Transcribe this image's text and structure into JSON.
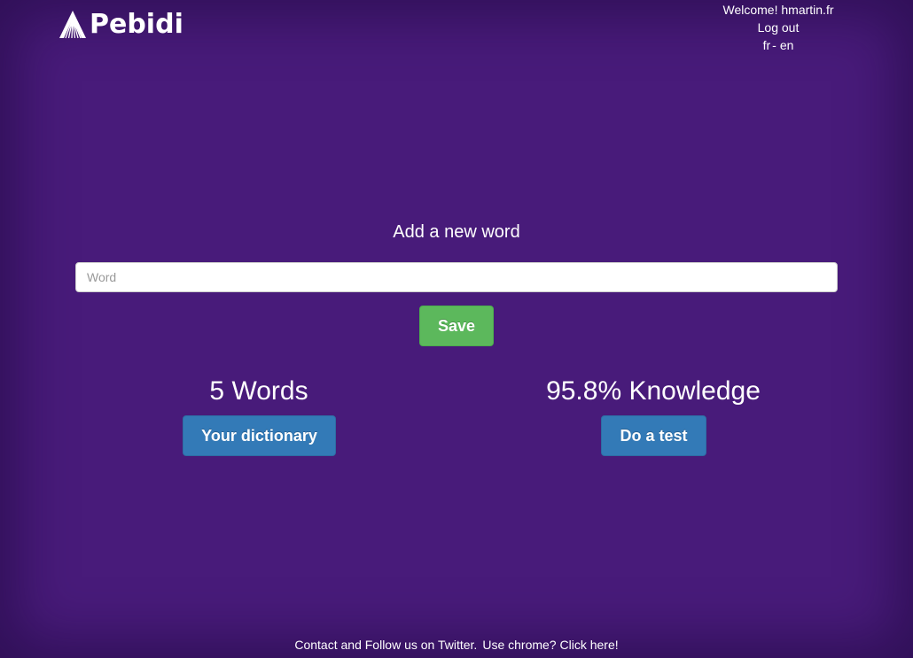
{
  "brand": {
    "name": "Pebidi",
    "logo_icon": "pebidi-logo-icon"
  },
  "user": {
    "welcome": "Welcome! hmartin.fr",
    "logout": "Log out",
    "languages": [
      "fr",
      "en"
    ],
    "lang_separator": "-"
  },
  "add_word": {
    "title": "Add a new word",
    "placeholder": "Word",
    "value": "",
    "save_label": "Save"
  },
  "stats": {
    "words": "5 Words",
    "dictionary_button": "Your dictionary",
    "knowledge": "95.8% Knowledge",
    "test_button": "Do a test"
  },
  "footer": {
    "contact": "Contact",
    "and_text": " and ",
    "follow": "Follow us on Twitter.",
    "chrome_text": "Use chrome? ",
    "click_here": "Click here!"
  },
  "colors": {
    "background": "#481b7a",
    "save_button": "#5cb85c",
    "primary_button": "#337ab7"
  }
}
